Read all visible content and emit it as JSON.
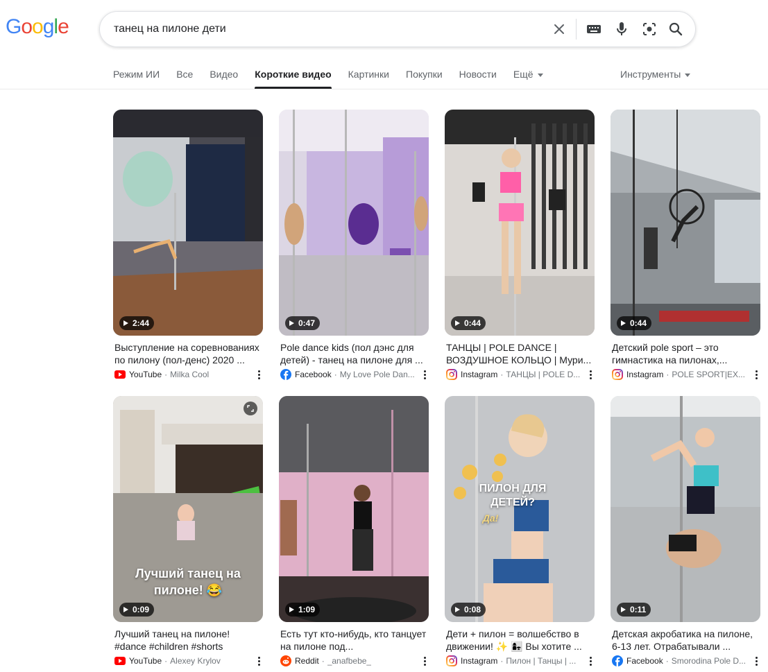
{
  "logo": {
    "text": [
      "G",
      "o",
      "o",
      "g",
      "l",
      "e"
    ],
    "colors": [
      "#4285f4",
      "#ea4335",
      "#fbbc05",
      "#4285f4",
      "#34a853",
      "#ea4335"
    ]
  },
  "search": {
    "query": "танец на пилоне дети"
  },
  "tabs": [
    {
      "label": "Режим ИИ"
    },
    {
      "label": "Все"
    },
    {
      "label": "Видео"
    },
    {
      "label": "Короткие видео",
      "active": true
    },
    {
      "label": "Картинки"
    },
    {
      "label": "Покупки"
    },
    {
      "label": "Новости"
    },
    {
      "label": "Ещё"
    }
  ],
  "tools_label": "Инструменты",
  "colors": {
    "youtube": "#ff0000",
    "facebook": "#1877f2",
    "reddit": "#ff4500",
    "accent": "#202124"
  },
  "results": [
    {
      "duration": "2:44",
      "title": "Выступление на соревнованиях по пилону (пол-денс) 2020 ...",
      "source": "YouTube",
      "channel": "Milka Cool",
      "source_icon": "youtube-icon"
    },
    {
      "duration": "0:47",
      "title": "Pole dance kids (пол дэнс для детей) - танец на пилоне для ...",
      "source": "Facebook",
      "channel": "My Love Pole Dan...",
      "source_icon": "facebook-icon"
    },
    {
      "duration": "0:44",
      "title": "ТАНЦЫ | POLE DANCE | ВОЗДУШНОЕ КОЛЬЦО | Мури...",
      "source": "Instagram",
      "channel": "ТАНЦЫ | POLE D...",
      "source_icon": "instagram-icon"
    },
    {
      "duration": "0:44",
      "title": "Детский pole sport – это гимнастика на пилонах,...",
      "source": "Instagram",
      "channel": "POLE SPORT|EX...",
      "source_icon": "instagram-icon"
    },
    {
      "duration": "0:09",
      "title": "Лучший танец на пилоне! #dance #children #shorts",
      "source": "YouTube",
      "channel": "Alexey Krylov",
      "source_icon": "youtube-icon",
      "overlay": "Лучший танец на пилоне! 😂"
    },
    {
      "duration": "1:09",
      "title": "Есть тут кто-нибудь, кто танцует на пилоне под...",
      "source": "Reddit",
      "channel": "_anafbebe_",
      "source_icon": "reddit-icon"
    },
    {
      "duration": "0:08",
      "title": "Дети + пилон = волшебство в движении! ✨ 👩‍👧 Вы хотите ...",
      "source": "Instagram",
      "channel": "Пилон | Танцы | ...",
      "source_icon": "instagram-icon",
      "overlay": "ПИЛОН ДЛЯ ДЕТЕЙ?",
      "overlay2": "Да!"
    },
    {
      "duration": "0:11",
      "title": "Детская акробатика на пилоне, 6-13 лет. Отрабатывали ...",
      "source": "Facebook",
      "channel": "Smorodina Pole D...",
      "source_icon": "facebook-icon"
    }
  ]
}
